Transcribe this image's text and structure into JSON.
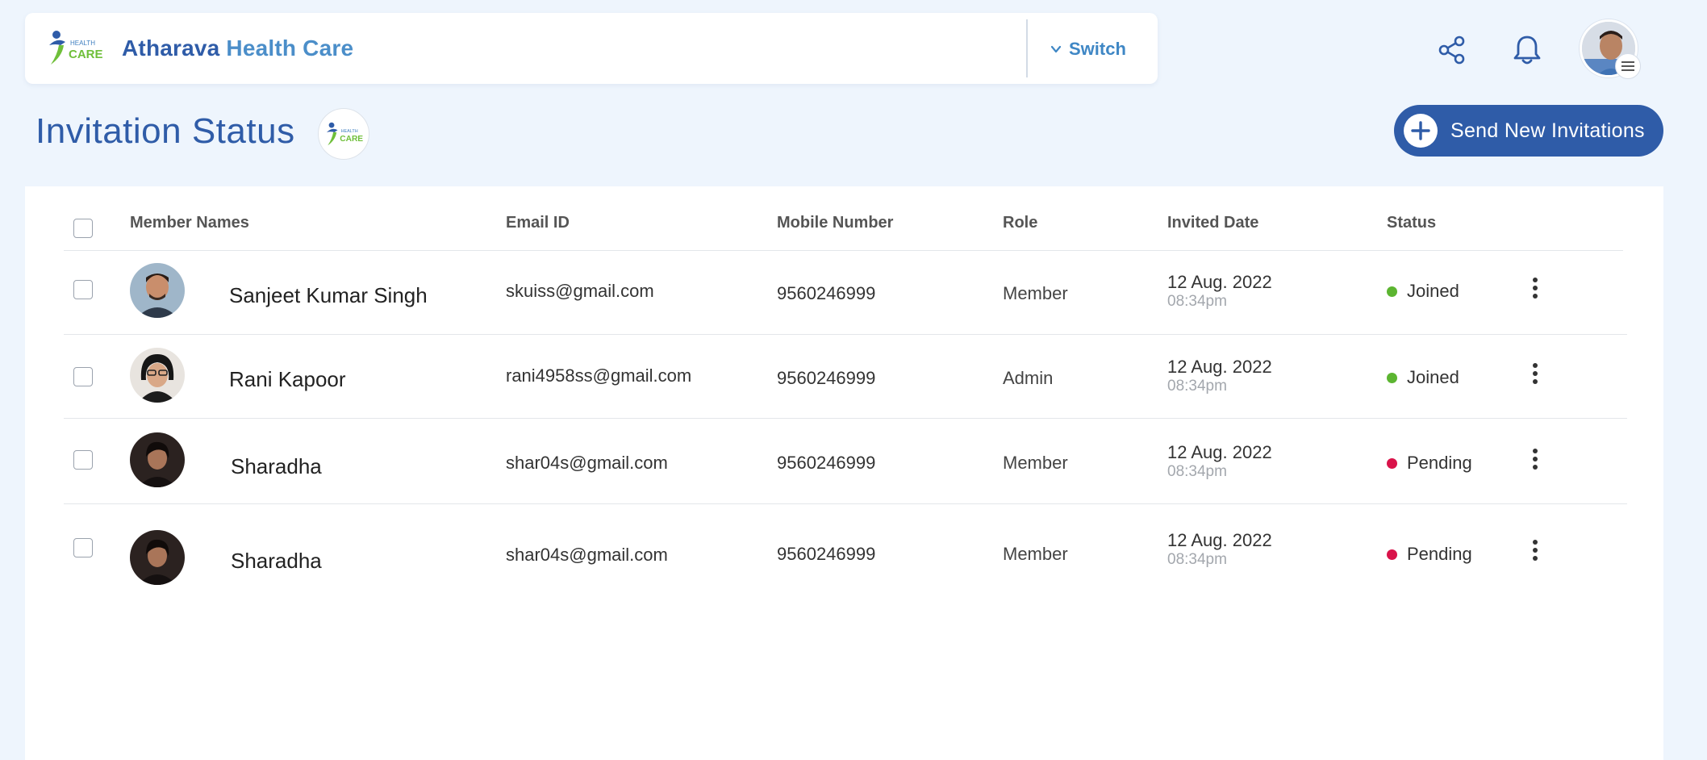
{
  "header": {
    "org_name_part1": "Atharava",
    "org_name_part2": "Health Care",
    "switch_label": "Switch",
    "logo_text_top": "HEALTH",
    "logo_text_bottom": "CARE"
  },
  "page": {
    "title": "Invitation Status",
    "send_button_label": "Send New Invitations"
  },
  "table": {
    "columns": [
      "Member Names",
      "Email ID",
      "Mobile Number",
      "Role",
      "Invited Date",
      "Status"
    ],
    "rows": [
      {
        "name": "Sanjeet Kumar Singh",
        "email": "skuiss@gmail.com",
        "mobile": "9560246999",
        "role": "Member",
        "date": "12 Aug. 2022",
        "time": "08:34pm",
        "status": "Joined"
      },
      {
        "name": "Rani Kapoor",
        "email": "rani4958ss@gmail.com",
        "mobile": "9560246999",
        "role": "Admin",
        "date": "12 Aug. 2022",
        "time": "08:34pm",
        "status": "Joined"
      },
      {
        "name": "Sharadha",
        "email": "shar04s@gmail.com",
        "mobile": "9560246999",
        "role": "Member",
        "date": "12 Aug. 2022",
        "time": "08:34pm",
        "status": "Pending"
      },
      {
        "name": "Sharadha",
        "email": "shar04s@gmail.com",
        "mobile": "9560246999",
        "role": "Member",
        "date": "12 Aug. 2022",
        "time": "08:34pm",
        "status": "Pending"
      }
    ]
  },
  "colors": {
    "brand_blue": "#2f5ca8",
    "accent_blue": "#4b8ec9",
    "joined_green": "#5cb531",
    "pending_red": "#d9134a"
  },
  "icons": {
    "share": "share-icon",
    "notifications": "bell-icon",
    "menu": "menu-icon",
    "more": "kebab-icon",
    "add": "plus-icon",
    "switch_chevron": "chevron-down-icon"
  }
}
